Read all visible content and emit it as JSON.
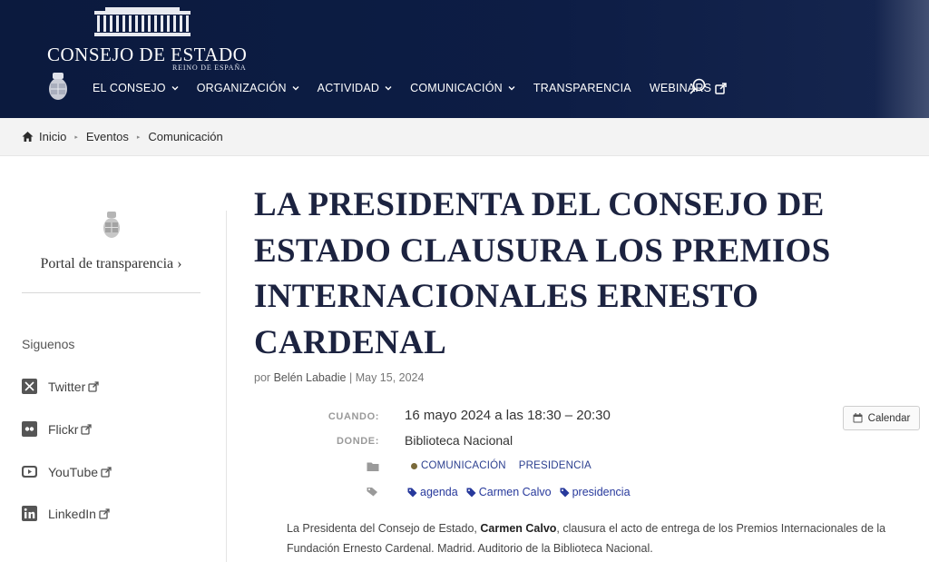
{
  "header": {
    "logo_name": "CONSEJO DE ESTADO",
    "logo_sub": "REINO DE ESPAÑA",
    "nav": [
      {
        "label": "EL CONSEJO"
      },
      {
        "label": "ORGANIZACIÓN"
      },
      {
        "label": "ACTIVIDAD"
      },
      {
        "label": "COMUNICACIÓN"
      },
      {
        "label": "TRANSPARENCIA"
      },
      {
        "label": "WEBINARS"
      }
    ]
  },
  "breadcrumb": [
    "Inicio",
    "Eventos",
    "Comunicación"
  ],
  "sidebar": {
    "portal_label": "Portal de transparencia ›",
    "follow_label": "Siguenos",
    "social": [
      {
        "label": "Twitter",
        "icon": "x-icon"
      },
      {
        "label": "Flickr",
        "icon": "flickr-icon"
      },
      {
        "label": "YouTube",
        "icon": "youtube-icon"
      },
      {
        "label": "LinkedIn",
        "icon": "linkedin-icon"
      }
    ]
  },
  "article": {
    "title": "LA PRESIDENTA DEL CONSEJO DE ESTADO CLAUSURA LOS PREMIOS INTERNACIONALES ERNESTO CARDENAL",
    "meta_prefix": "por",
    "author": "Belén Labadie",
    "meta_sep": "|",
    "date": "May 15, 2024",
    "when_label": "CUANDO:",
    "when_value": "16 mayo 2024 a las 18:30 – 20:30",
    "where_label": "DONDE:",
    "where_value": "Biblioteca Nacional",
    "categories": [
      "COMUNICACIÓN",
      "PRESIDENCIA"
    ],
    "tags": [
      "agenda",
      "Carmen Calvo",
      "presidencia"
    ],
    "calendar_button": "Calendar",
    "body_prefix": "La Presidenta del Consejo de Estado,",
    "body_bold": "Carmen Calvo",
    "body_suffix": ", clausura el acto de entrega de los Premios Internacionales de la Fundación Ernesto Cardenal. Madrid. Auditorio de la Biblioteca Nacional."
  },
  "colors": {
    "header_bg": "#0d1d45",
    "title_color": "#1c2340",
    "link_color": "#27399c",
    "category_dot": "#7a6a3a"
  }
}
